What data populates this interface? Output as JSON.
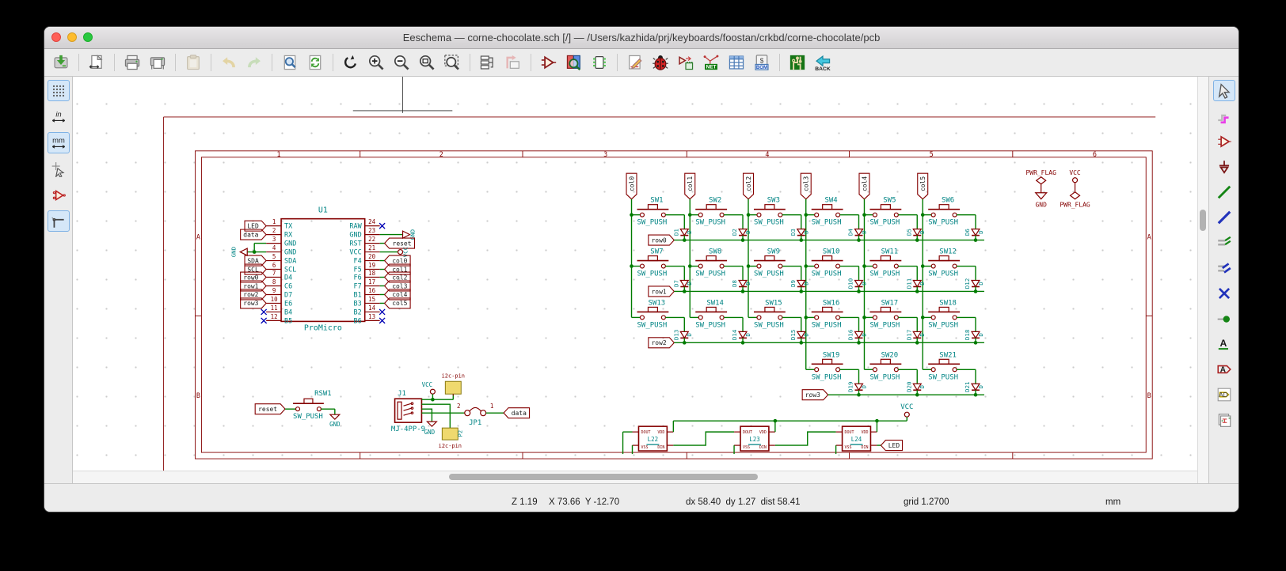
{
  "window": {
    "title": "Eeschema — corne-chocolate.sch [/] — /Users/kazhida/prj/keyboards/foostan/crkbd/corne-chocolate/pcb"
  },
  "toolbar": {
    "groups": [
      [
        "save"
      ],
      [
        "sheet-settings"
      ],
      [
        "print",
        "plot"
      ],
      [
        "paste"
      ],
      [
        "undo",
        "redo"
      ],
      [
        "find",
        "find-replace"
      ],
      [
        "redraw",
        "zoom-in",
        "zoom-out",
        "zoom-fit",
        "zoom-selection"
      ],
      [
        "hierarchy-navigator",
        "leave-sheet"
      ],
      [
        "symbol-editor",
        "symbol-browser",
        "footprint-chooser"
      ],
      [
        "annotate",
        "erc",
        "assign-footprints",
        "netlist",
        "symbol-fields-table",
        "bom"
      ],
      [
        "pcbnew",
        "back-import"
      ]
    ],
    "disabled": [
      "paste",
      "undo",
      "redo",
      "leave-sheet"
    ],
    "netlist_label": "NET",
    "bom_label": "BOM",
    "bom_currency": "$",
    "back_label": "BACK"
  },
  "left_toolbar": {
    "units_in": "in",
    "units_mm": "mm",
    "items": [
      {
        "name": "grid-toggle",
        "selected": true
      },
      {
        "name": "units-in",
        "selected": false
      },
      {
        "name": "units-mm",
        "selected": true
      },
      {
        "name": "cursor-shape",
        "selected": false
      },
      {
        "name": "hidden-pins",
        "selected": false
      },
      {
        "name": "ortho-wires",
        "selected": true
      }
    ]
  },
  "right_toolbar": {
    "label_a": "A",
    "label_ad": "AD",
    "items": [
      {
        "name": "cursor",
        "selected": true
      },
      {
        "name": "highlight-net",
        "selected": false
      },
      {
        "name": "place-symbol",
        "selected": false
      },
      {
        "name": "place-power",
        "selected": false
      },
      {
        "name": "place-wire",
        "selected": false
      },
      {
        "name": "place-bus",
        "selected": false
      },
      {
        "name": "wire-to-bus",
        "selected": false
      },
      {
        "name": "bus-to-bus",
        "selected": false
      },
      {
        "name": "no-connect",
        "selected": false
      },
      {
        "name": "place-junction",
        "selected": false
      },
      {
        "name": "place-label",
        "selected": false
      },
      {
        "name": "place-global-label",
        "selected": false
      },
      {
        "name": "place-hier-label",
        "selected": false
      },
      {
        "name": "place-hier-sheet",
        "selected": false
      }
    ]
  },
  "status": {
    "zoom": "Z 1.19",
    "position": "X 73.66  Y -12.70",
    "delta": "dx 58.40  dy 1.27  dist 58.41",
    "grid": "grid 1.2700",
    "units": "mm"
  },
  "schematic": {
    "colors": {
      "wire": "#007b00",
      "component": "#840000",
      "fields": "#008484",
      "frame": "#840000",
      "noconnect": "#0000b4",
      "glabel_text": "#1a1a1a"
    },
    "sheet": {
      "columns": [
        "1",
        "2",
        "3",
        "4",
        "5",
        "6"
      ],
      "rows": [
        "A",
        "B"
      ]
    },
    "mcu": {
      "ref": "U1",
      "value": "ProMicro",
      "gnd_text": "GND",
      "vcc_text": "VCC",
      "left_pins": [
        {
          "num": "1",
          "name": "TX",
          "conn": "label",
          "label": "LED"
        },
        {
          "num": "2",
          "name": "RX",
          "conn": "label",
          "label": "data"
        },
        {
          "num": "3",
          "name": "GND",
          "conn": "gnd"
        },
        {
          "num": "4",
          "name": "GND",
          "conn": "gnd"
        },
        {
          "num": "5",
          "name": "SDA",
          "conn": "label",
          "label": "SDA"
        },
        {
          "num": "6",
          "name": "SCL",
          "conn": "label",
          "label": "SCL"
        },
        {
          "num": "7",
          "name": "D4",
          "conn": "label",
          "label": "row0"
        },
        {
          "num": "8",
          "name": "C6",
          "conn": "label",
          "label": "row1"
        },
        {
          "num": "9",
          "name": "D7",
          "conn": "label",
          "label": "row2"
        },
        {
          "num": "10",
          "name": "E6",
          "conn": "label",
          "label": "row3"
        },
        {
          "num": "11",
          "name": "B4",
          "conn": "nc"
        },
        {
          "num": "12",
          "name": "B5",
          "conn": "nc"
        }
      ],
      "right_pins": [
        {
          "num": "24",
          "name": "RAW",
          "conn": "nc"
        },
        {
          "num": "23",
          "name": "GND",
          "conn": "gnd_flag"
        },
        {
          "num": "22",
          "name": "RST",
          "conn": "label",
          "label": "reset"
        },
        {
          "num": "21",
          "name": "VCC",
          "conn": "vcc_flag"
        },
        {
          "num": "20",
          "name": "F4",
          "conn": "label",
          "label": "col0"
        },
        {
          "num": "19",
          "name": "F5",
          "conn": "label",
          "label": "col1"
        },
        {
          "num": "18",
          "name": "F6",
          "conn": "label",
          "label": "col2"
        },
        {
          "num": "17",
          "name": "F7",
          "conn": "label",
          "label": "col3"
        },
        {
          "num": "16",
          "name": "B1",
          "conn": "label",
          "label": "col4"
        },
        {
          "num": "15",
          "name": "B3",
          "conn": "label",
          "label": "col5"
        },
        {
          "num": "14",
          "name": "B2",
          "conn": "nc"
        },
        {
          "num": "13",
          "name": "B6",
          "conn": "nc"
        }
      ]
    },
    "matrix": {
      "col_labels": [
        "col0",
        "col1",
        "col2",
        "col3",
        "col4",
        "col5"
      ],
      "sw_value": "SW_PUSH",
      "diode_value": "D",
      "rows": [
        {
          "label": "row0",
          "col_start": 0,
          "switches": [
            "SW1",
            "SW2",
            "SW3",
            "SW4",
            "SW5",
            "SW6"
          ],
          "diodes": [
            "D1",
            "D2",
            "D3",
            "D4",
            "D5",
            "D6"
          ]
        },
        {
          "label": "row1",
          "col_start": 0,
          "switches": [
            "SW7",
            "SW8",
            "SW9",
            "SW10",
            "SW11",
            "SW12"
          ],
          "diodes": [
            "D7",
            "D8",
            "D9",
            "D10",
            "D11",
            "D12"
          ]
        },
        {
          "label": "row2",
          "col_start": 0,
          "switches": [
            "SW13",
            "SW14",
            "SW15",
            "SW16",
            "SW17",
            "SW18"
          ],
          "diodes": [
            "D13",
            "D14",
            "D15",
            "D16",
            "D17",
            "D18"
          ]
        },
        {
          "label": "row3",
          "col_start": 3,
          "switches": [
            "SW19",
            "SW20",
            "SW21"
          ],
          "diodes": [
            "D19",
            "D20",
            "D21"
          ]
        }
      ]
    },
    "leds": {
      "refs": [
        "L22",
        "L23",
        "L24"
      ],
      "pins": {
        "tl": "DOUT",
        "tr": "VDD",
        "bl": "VSS",
        "br": "DIN"
      },
      "vcc": "VCC",
      "out_label": "LED"
    },
    "reset_switch": {
      "label": "reset",
      "ref": "RSW1",
      "value": "SW_PUSH",
      "gnd": "GND"
    },
    "trrs": {
      "ref": "J1",
      "value": "MJ-4PP-9",
      "vcc": "VCC",
      "gnd": "GND",
      "i2c_label_top": "i2c-pin",
      "i2c_label_bottom": "i2c-pin",
      "p_ref": "P2",
      "jumper": {
        "ref": "JP1",
        "pin_left": "2",
        "pin_right": "1"
      },
      "data_label": "data"
    },
    "power_flags": {
      "left": {
        "top": "PWR_FLAG",
        "bottom": "GND"
      },
      "right": {
        "top": "VCC",
        "bottom": "PWR_FLAG"
      }
    }
  }
}
